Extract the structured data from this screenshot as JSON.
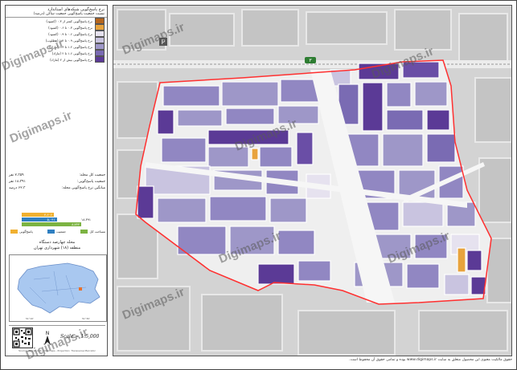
{
  "legend": {
    "title": "نرخ پاسخ‌گویی شبکه‌های استاندارد",
    "subtitle": "نسبت جمعیت پاسخ‌گویی جمعیت ساکن (درصد)",
    "classes": [
      {
        "label": "نرخ پاسخ‌گویی کمتر از ۰.۳ (کمبود)",
        "color": "#b5651d"
      },
      {
        "label": "نرخ پاسخ‌گویی ۰.۳ تا ۰.۶ (کمبود)",
        "color": "#e8a33d"
      },
      {
        "label": "نرخ پاسخ‌گویی ۰.۶ تا ۰.۹ (کمبود)",
        "color": "#e6e2ef"
      },
      {
        "label": "نرخ پاسخ‌گویی ۰.۹ تا ۱.۲ (مطلوب)",
        "color": "#c9c4e0"
      },
      {
        "label": "نرخ پاسخ‌گویی ۱.۲ تا ۱.۶ (مازاد)",
        "color": "#9e97c8"
      },
      {
        "label": "نرخ پاسخ‌گویی ۱.۶ تا ۲ (مازاد)",
        "color": "#7a6bb3"
      },
      {
        "label": "نرخ پاسخ‌گویی بیش از ۲ (مازاد)",
        "color": "#5b3a96"
      }
    ]
  },
  "stats": [
    {
      "label": "جمعیت کل محله:",
      "value": "۲،۳۵۹ نفر"
    },
    {
      "label": "جمعیت پاسخ‌گویی:",
      "value": "۱۸،۳۹۱ نفر"
    },
    {
      "label": "میانگین نرخ پاسخ‌گویی محله:",
      "value": "۶۲.۳ درصد"
    }
  ],
  "bars": [
    {
      "label": "۴،۶۰۶",
      "value": 4606,
      "color": "#f0b030"
    },
    {
      "label": "۵،۰۴۱",
      "value": 5041,
      "color": "#2f7fc1"
    },
    {
      "label": "۸،۷۴۴",
      "value": 8744,
      "color": "#7cb342"
    }
  ],
  "bars_total": "۱۸،۳۹۱",
  "bar_legend": [
    {
      "label": "پاسخ‌گویی",
      "color": "#f0b030"
    },
    {
      "label": "جمعیت",
      "color": "#2f7fc1"
    },
    {
      "label": "مساحت کل",
      "color": "#7cb342"
    }
  ],
  "location": {
    "title": "محله چهارصد دستگاه",
    "subtitle": "منطقه (۱۸) شهرداری تهران"
  },
  "scale_text": "Scale = 1:5,000",
  "north_label": "N",
  "fine_print": "Source: Tehran GIS / Digimaps - Projection: Transverse Mercator",
  "watermark_text": "Digimaps.ir",
  "copyright": "حقوق مالکیت معنوی این محصول متعلق به سایت www.digimaps.ir بوده و تمامی حقوق آن محفوظ است.",
  "map_labels": {
    "parking_icon": "P",
    "road_badge": "۳"
  },
  "colors": {
    "boundary": "#ff3030",
    "road": "#f4f4f4",
    "basemap": "#cfcfcf",
    "block_dark": "#6a4ea6",
    "block_mid": "#9187c2",
    "block_light": "#c9c4e0",
    "block_pale": "#e6e2ef",
    "block_orange": "#e8a33d"
  }
}
